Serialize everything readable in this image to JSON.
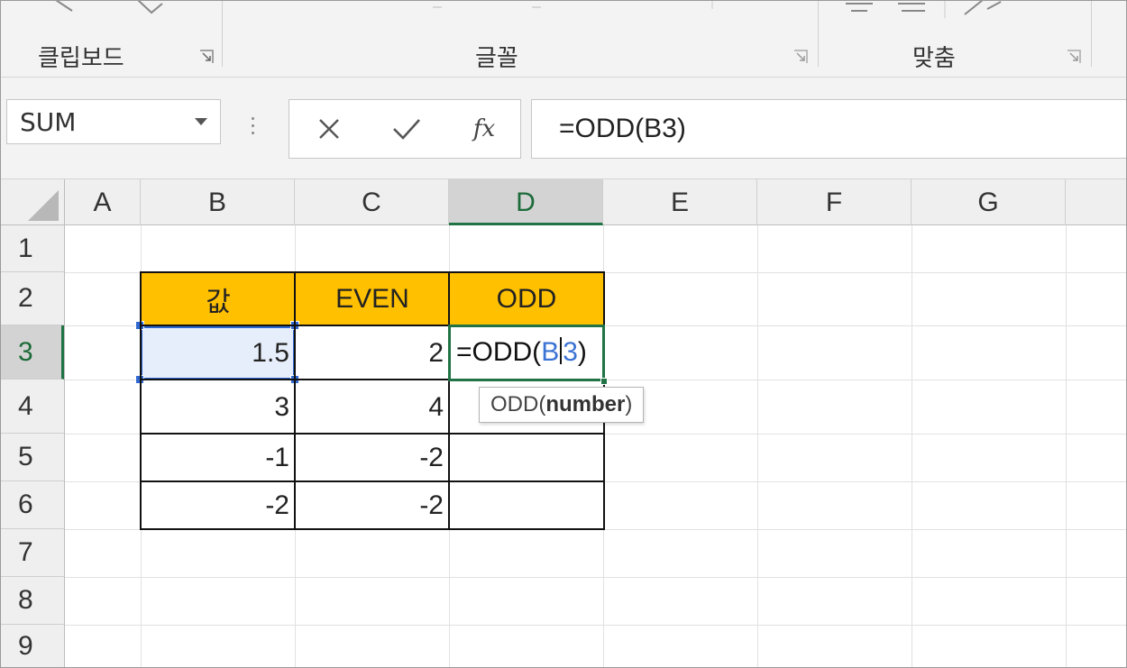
{
  "ribbon": {
    "groups": [
      {
        "label": "클립보드"
      },
      {
        "label": "글꼴"
      },
      {
        "label": "맞춤"
      }
    ]
  },
  "formula_bar": {
    "name_box": "SUM",
    "cancel_icon": "close-icon",
    "enter_icon": "check-icon",
    "function_icon_label": "fx",
    "formula": "=ODD(B3)"
  },
  "sheet": {
    "columns": [
      "A",
      "B",
      "C",
      "D",
      "E",
      "F",
      "G"
    ],
    "rows": [
      "1",
      "2",
      "3",
      "4",
      "5",
      "6",
      "7",
      "8",
      "9"
    ],
    "active_column": "D",
    "active_row": "3",
    "table": {
      "headers": [
        "값",
        "EVEN",
        "ODD"
      ],
      "header_color": "#ffc000",
      "values": [
        [
          "1.5",
          "2"
        ],
        [
          "3",
          "4"
        ],
        [
          "-1",
          "-2"
        ],
        [
          "-2",
          "-2"
        ]
      ]
    },
    "editing_cell": {
      "prefix": "=ODD(",
      "ref_part1": "B",
      "ref_part2": "3",
      "suffix": ")",
      "ref_color": "#3b73d4"
    },
    "tooltip": {
      "func": "ODD(",
      "arg": "number",
      "close": ")"
    }
  },
  "colors": {
    "accent_green": "#217346",
    "reference_blue": "#2f68d0"
  }
}
